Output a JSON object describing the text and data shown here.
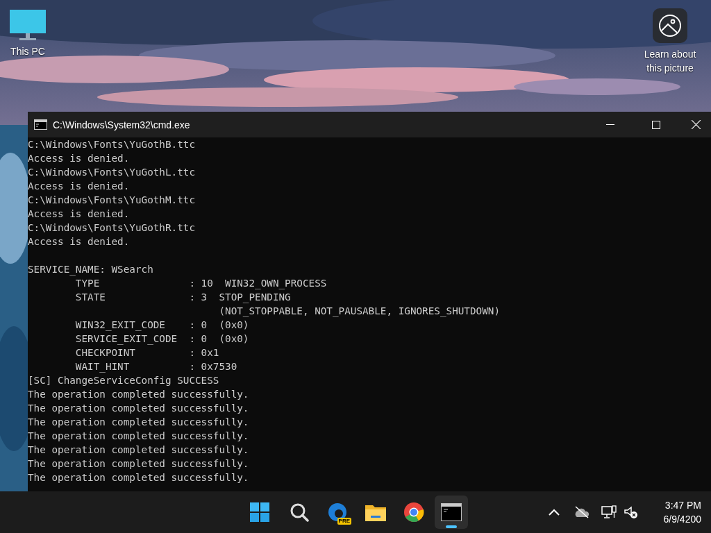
{
  "desktop": {
    "icons": [
      {
        "label": "This PC",
        "kind": "computer"
      }
    ],
    "spotlight": {
      "label_lines": [
        "Learn about",
        "this picture"
      ]
    }
  },
  "window": {
    "title": "C:\\Windows\\System32\\cmd.exe",
    "blocks": [
      {
        "lines": [
          {
            "text": "C:\\Windows\\Fonts\\YuGothB.ttc"
          },
          {
            "text": "Access is denied."
          },
          {
            "text": "C:\\Windows\\Fonts\\YuGothL.ttc"
          },
          {
            "text": "Access is denied."
          },
          {
            "text": "C:\\Windows\\Fonts\\YuGothM.ttc"
          },
          {
            "text": "Access is denied."
          },
          {
            "text": "C:\\Windows\\Fonts\\YuGothR.ttc"
          },
          {
            "text": "Access is denied."
          }
        ]
      },
      {
        "lines": [
          {
            "text": "SERVICE_NAME: WSearch"
          },
          {
            "text": "        TYPE               : 10  WIN32_OWN_PROCESS"
          },
          {
            "text": "        STATE              : 3  STOP_PENDING"
          },
          {
            "text": "                                (NOT_STOPPABLE, NOT_PAUSABLE, IGNORES_SHUTDOWN)"
          },
          {
            "text": "        WIN32_EXIT_CODE    : 0  (0x0)"
          },
          {
            "text": "        SERVICE_EXIT_CODE  : 0  (0x0)"
          },
          {
            "text": "        CHECKPOINT         : 0x1"
          },
          {
            "text": "        WAIT_HINT          : 0x7530"
          },
          {
            "text": "[SC] ChangeServiceConfig SUCCESS"
          },
          {
            "text": "The operation completed successfully."
          },
          {
            "text": "The operation completed successfully."
          },
          {
            "text": "The operation completed successfully."
          },
          {
            "text": "The operation completed successfully."
          },
          {
            "text": "The operation completed successfully."
          },
          {
            "text": "The operation completed successfully."
          },
          {
            "text": "The operation completed successfully."
          }
        ]
      }
    ]
  },
  "taskbar": {
    "apps": [
      {
        "kind": "start",
        "selected": false
      },
      {
        "kind": "search",
        "selected": false
      },
      {
        "kind": "edge",
        "badge": "PRE",
        "selected": false
      },
      {
        "kind": "folder",
        "selected": false
      },
      {
        "kind": "chrome",
        "selected": false
      },
      {
        "kind": "terminal",
        "selected": true
      }
    ],
    "tray": [
      {
        "kind": "chevron"
      },
      {
        "kind": "cloud"
      },
      {
        "kind": "network"
      },
      {
        "kind": "volume"
      }
    ],
    "clock": {
      "time": "3:47 PM",
      "date": "6/9/4200"
    }
  }
}
